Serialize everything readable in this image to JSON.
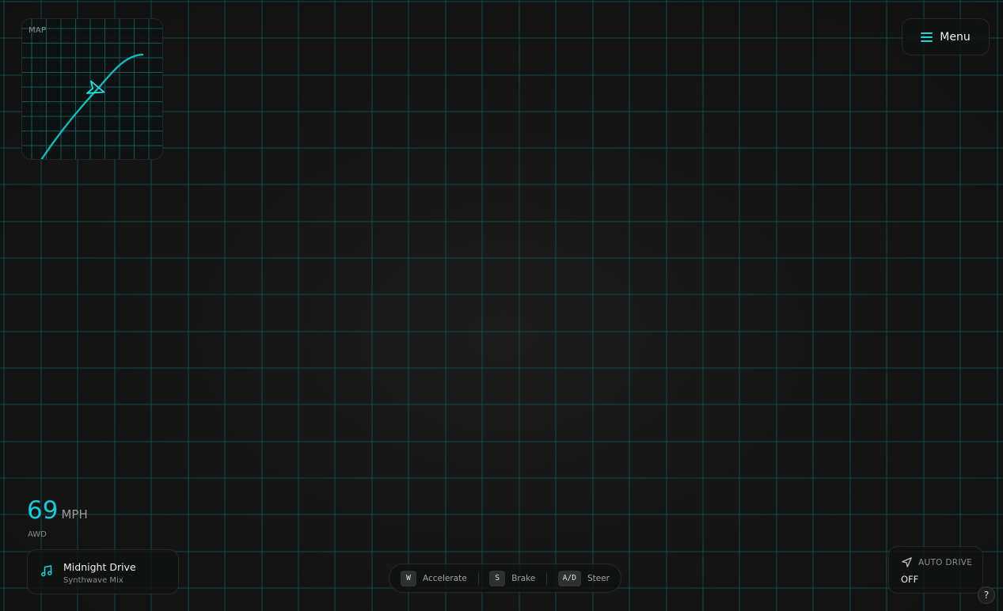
{
  "minimap": {
    "label": "MAP",
    "icon": "navigation-arrow-icon",
    "route_color": "#14b8b8"
  },
  "menu": {
    "label": "Menu",
    "icon": "hamburger-icon"
  },
  "hud": {
    "speed_value": "69",
    "speed_unit": "MPH",
    "drive_mode": "AWD",
    "accent_color": "#1cc8d8"
  },
  "music": {
    "icon": "music-note-icon",
    "title": "Midnight Drive",
    "subtitle": "Synthwave Mix"
  },
  "controls": [
    {
      "key": "W",
      "action": "Accelerate"
    },
    {
      "key": "S",
      "action": "Brake"
    },
    {
      "key": "A/D",
      "action": "Steer"
    }
  ],
  "auto_drive": {
    "icon": "navigation-arrow-icon",
    "label": "AUTO DRIVE",
    "state": "OFF"
  },
  "help": {
    "label": "?"
  },
  "colors": {
    "background": "#141414",
    "grid_line": "#0f4a4a",
    "accent": "#1ed4d4"
  }
}
